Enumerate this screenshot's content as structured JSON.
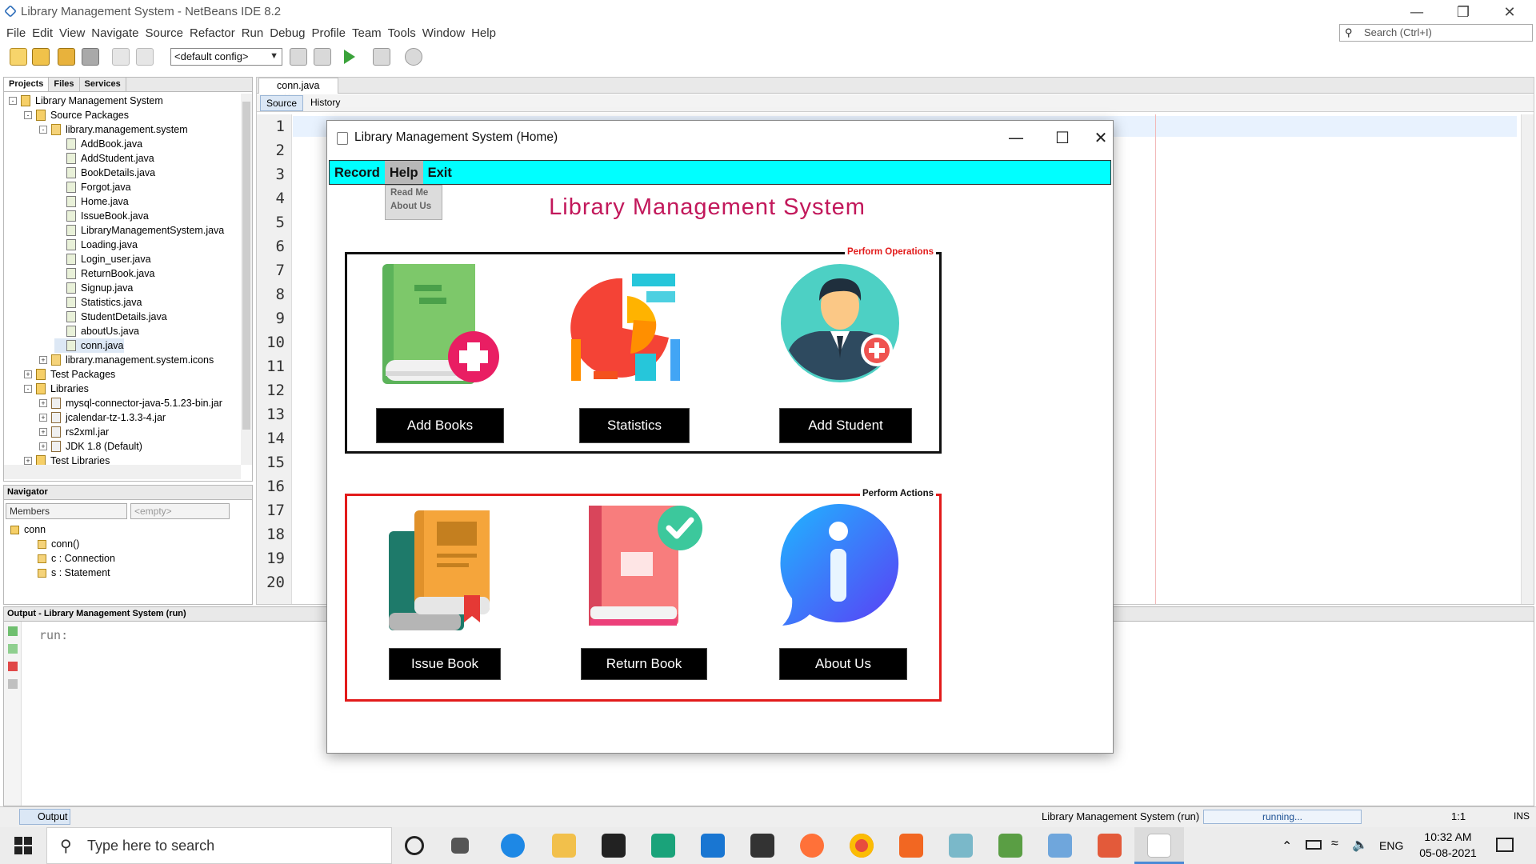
{
  "ide": {
    "title": "Library Management System - NetBeans IDE 8.2",
    "menu": [
      "File",
      "Edit",
      "View",
      "Navigate",
      "Source",
      "Refactor",
      "Run",
      "Debug",
      "Profile",
      "Team",
      "Tools",
      "Window",
      "Help"
    ],
    "search_placeholder": "Search (Ctrl+I)",
    "config": "<default config>"
  },
  "projects": {
    "tabs": [
      "Projects",
      "Files",
      "Services"
    ],
    "tree": [
      {
        "label": "Library Management System",
        "depth": 0,
        "icon": "project-icon",
        "exp": "-"
      },
      {
        "label": "Source Packages",
        "depth": 1,
        "icon": "folder-icon",
        "exp": "-"
      },
      {
        "label": "library.management.system",
        "depth": 2,
        "icon": "package-icon",
        "exp": "-"
      },
      {
        "label": "AddBook.java",
        "depth": 3,
        "icon": "java-file-icon"
      },
      {
        "label": "AddStudent.java",
        "depth": 3,
        "icon": "java-file-icon"
      },
      {
        "label": "BookDetails.java",
        "depth": 3,
        "icon": "java-file-icon"
      },
      {
        "label": "Forgot.java",
        "depth": 3,
        "icon": "java-file-icon"
      },
      {
        "label": "Home.java",
        "depth": 3,
        "icon": "java-file-icon"
      },
      {
        "label": "IssueBook.java",
        "depth": 3,
        "icon": "java-file-icon"
      },
      {
        "label": "LibraryManagementSystem.java",
        "depth": 3,
        "icon": "java-file-icon"
      },
      {
        "label": "Loading.java",
        "depth": 3,
        "icon": "java-file-icon"
      },
      {
        "label": "Login_user.java",
        "depth": 3,
        "icon": "java-file-icon"
      },
      {
        "label": "ReturnBook.java",
        "depth": 3,
        "icon": "java-file-icon"
      },
      {
        "label": "Signup.java",
        "depth": 3,
        "icon": "java-file-icon"
      },
      {
        "label": "Statistics.java",
        "depth": 3,
        "icon": "java-file-icon"
      },
      {
        "label": "StudentDetails.java",
        "depth": 3,
        "icon": "java-file-icon"
      },
      {
        "label": "aboutUs.java",
        "depth": 3,
        "icon": "java-file-icon"
      },
      {
        "label": "conn.java",
        "depth": 3,
        "icon": "java-file-icon",
        "selected": true
      },
      {
        "label": "library.management.system.icons",
        "depth": 2,
        "icon": "package-icon",
        "exp": "+"
      },
      {
        "label": "Test Packages",
        "depth": 1,
        "icon": "folder-icon",
        "exp": "+"
      },
      {
        "label": "Libraries",
        "depth": 1,
        "icon": "folder-icon",
        "exp": "-"
      },
      {
        "label": "mysql-connector-java-5.1.23-bin.jar",
        "depth": 2,
        "icon": "jar-icon",
        "exp": "+"
      },
      {
        "label": "jcalendar-tz-1.3.3-4.jar",
        "depth": 2,
        "icon": "jar-icon",
        "exp": "+"
      },
      {
        "label": "rs2xml.jar",
        "depth": 2,
        "icon": "jar-icon",
        "exp": "+"
      },
      {
        "label": "JDK 1.8 (Default)",
        "depth": 2,
        "icon": "jar-icon",
        "exp": "+"
      },
      {
        "label": "Test Libraries",
        "depth": 1,
        "icon": "folder-icon",
        "exp": "+"
      }
    ]
  },
  "navigator": {
    "title": "Navigator",
    "members": "Members",
    "filter": "<empty>",
    "tree": [
      {
        "label": "conn",
        "depth": 0
      },
      {
        "label": "conn()",
        "depth": 1
      },
      {
        "label": "c : Connection",
        "depth": 1
      },
      {
        "label": "s : Statement",
        "depth": 1
      }
    ]
  },
  "editor": {
    "tab": "conn.java",
    "source_label": "Source",
    "history_label": "History",
    "line_numbers": [
      "1",
      "2",
      "3",
      "4",
      "5",
      "6",
      "7",
      "8",
      "9",
      "10",
      "11",
      "12",
      "13",
      "14",
      "15",
      "16",
      "17",
      "18",
      "19",
      "20"
    ]
  },
  "output": {
    "title": "Output - Library Management System (run)",
    "text": "run:"
  },
  "status": {
    "output_tab": "Output",
    "project": "Library Management System (run)",
    "progress": "running...",
    "position": "1:1",
    "mode": "INS"
  },
  "taskbar": {
    "search": "Type here to search",
    "lang": "ENG",
    "time": "10:32 AM",
    "date": "05-08-2021"
  },
  "app": {
    "window_title": "Library Management System (Home)",
    "menu": [
      "Record",
      "Help",
      "Exit"
    ],
    "help_items": [
      "Read Me",
      "About Us"
    ],
    "title": "Library Management System",
    "group1_title": "Perform Operations",
    "group2_title": "Perform Actions",
    "buttons": {
      "add_books": "Add Books",
      "statistics": "Statistics",
      "add_student": "Add Student",
      "issue_book": "Issue Book",
      "return_book": "Return Book",
      "about_us": "About Us"
    },
    "colors": {
      "menu_bg": "#00ffff",
      "title": "#c2185b",
      "group1_border": "#111111",
      "group2_border": "#e21b1b"
    }
  }
}
